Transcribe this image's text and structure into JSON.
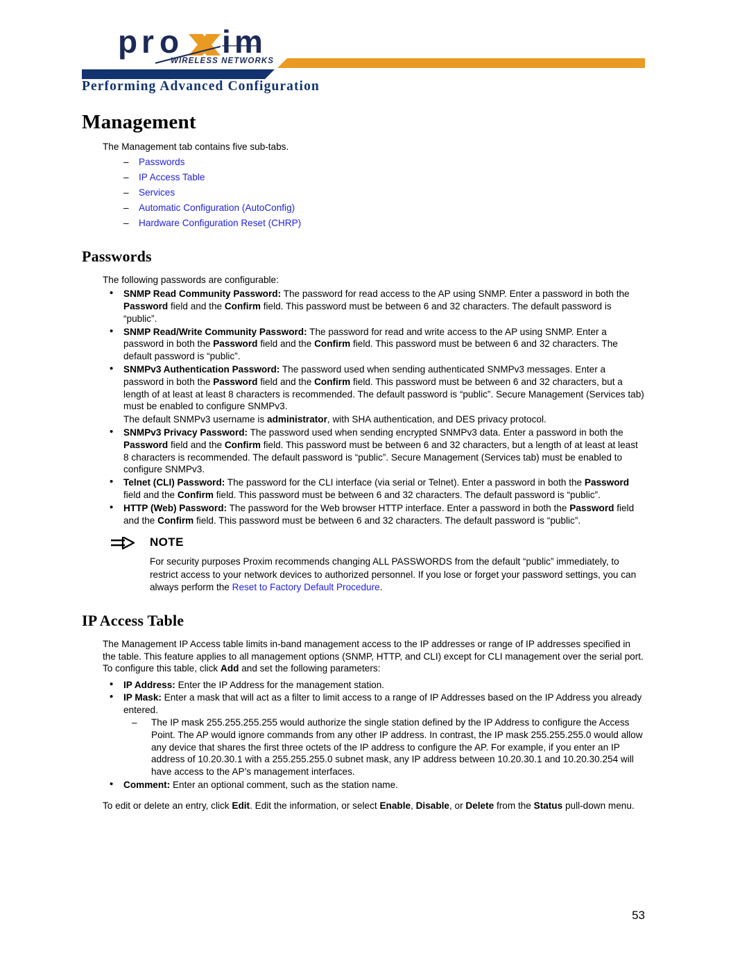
{
  "colors": {
    "navy": "#123370",
    "orange": "#e99a23",
    "link": "#2222dd",
    "text": "#000000"
  },
  "logo": {
    "wordmark": "proxim",
    "tagline": "WIRELESS NETWORKS",
    "x_letter": "X"
  },
  "header": {
    "running_head": "Performing Advanced Configuration"
  },
  "chapter": {
    "title": "Management",
    "intro": "The Management tab contains five sub-tabs.",
    "subtabs": [
      "Passwords",
      "IP Access Table",
      "Services",
      "Automatic Configuration (AutoConfig)",
      "Hardware Configuration Reset (CHRP)"
    ]
  },
  "passwords": {
    "title": "Passwords",
    "intro": "The following passwords are configurable:",
    "items": [
      {
        "term": "SNMP Read Community Password:",
        "text_1": " The password for read access to the AP using SNMP. Enter a password in both the ",
        "bold_1": "Password",
        "text_2": " field and the ",
        "bold_2": "Confirm",
        "text_3": " field. This password must be between 6 and 32 characters. The default password is “public”."
      },
      {
        "term": "SNMP Read/Write Community Password:",
        "text_1": " The password for read and write access to the AP using SNMP. Enter a password in both the ",
        "bold_1": "Password",
        "text_2": " field and the ",
        "bold_2": "Confirm",
        "text_3": " field. This password must be between 6 and 32 characters. The default password is “public”."
      },
      {
        "term": "SNMPv3 Authentication Password:",
        "text_1": " The password used when sending authenticated SNMPv3 messages. Enter a password in both the ",
        "bold_1": "Password",
        "text_2": " field and the ",
        "bold_2": "Confirm",
        "text_3": " field. This password must be between 6 and 32 characters, but a length of at least at least 8 characters is recommended. The default password is “public”. Secure Management (Services tab) must be enabled to configure SNMPv3."
      },
      {
        "term": "SNMPv3 Privacy Password:",
        "text_1": " The password used when sending encrypted SNMPv3 data. Enter a password in both the ",
        "bold_1": "Password",
        "text_2": " field and the ",
        "bold_2": "Confirm",
        "text_3": " field. This password must be between 6 and 32 characters, but a length of at least at least 8 characters is recommended. The default password is “public”. Secure Management (Services tab) must be enabled to configure SNMPv3."
      },
      {
        "term": "Telnet (CLI) Password:",
        "text_1": " The password for the CLI interface (via serial or Telnet). Enter a password in both the ",
        "bold_1": "Password",
        "text_2": " field and the ",
        "bold_2": "Confirm",
        "text_3": " field. This password must be between 6 and 32 characters. The default password is “public”."
      },
      {
        "term": "HTTP (Web) Password:",
        "text_1": " The password for the Web browser HTTP interface. Enter a password in both the ",
        "bold_1": "Password",
        "text_2": " field and the ",
        "bold_2": "Confirm",
        "text_3": " field. This password must be between 6 and 32 characters. The default password is “public”."
      }
    ],
    "snmpv3_username_note": {
      "text_1": "The default SNMPv3 username is ",
      "bold_1": "administrator",
      "text_2": ", with SHA authentication, and DES privacy protocol."
    }
  },
  "note": {
    "icon": "arrow-right-icon",
    "title": "NOTE",
    "text_1": "For security purposes Proxim recommends changing ALL PASSWORDS from the default “public” immediately, to restrict access to your network devices to authorized personnel. If you lose or forget your password settings, you can always perform the ",
    "link": "Reset to Factory Default Procedure",
    "text_2": "."
  },
  "ip_access_table": {
    "title": "IP Access Table",
    "intro_1": "The Management IP Access table limits in-band management access to the IP addresses or range of IP addresses specified in the table. This feature applies to all management options (SNMP, HTTP, and CLI) except for CLI management over the serial port. To configure this table, click ",
    "intro_bold": "Add",
    "intro_2": " and set the following parameters:",
    "items": [
      {
        "term": "IP Address:",
        "text": " Enter the IP Address for the management station."
      },
      {
        "term": "IP Mask:",
        "text": " Enter a mask that will act as a filter to limit access to a range of IP Addresses based on the IP Address you already entered.",
        "sub_items": [
          "The IP mask 255.255.255.255 would authorize the single station defined by the IP Address to configure the Access Point. The AP would ignore commands from any other IP address. In contrast, the IP mask 255.255.255.0 would allow any device that shares the first three octets of the IP address to configure the AP. For example, if you enter an IP address of 10.20.30.1 with a 255.255.255.0 subnet mask, any IP address between 10.20.30.1 and 10.20.30.254 will have access to the AP’s management interfaces."
        ]
      },
      {
        "term": "Comment:",
        "text": " Enter an optional comment, such as the station name."
      }
    ],
    "closing": {
      "text_1": "To edit or delete an entry, click ",
      "bold_1": "Edit",
      "text_2": ". Edit the information, or select ",
      "bold_2": "Enable",
      "text_3": ", ",
      "bold_3": "Disable",
      "text_4": ", or ",
      "bold_4": "Delete",
      "text_5": " from the ",
      "bold_5": "Status",
      "text_6": " pull-down menu."
    }
  },
  "footer": {
    "page_number": "53"
  }
}
